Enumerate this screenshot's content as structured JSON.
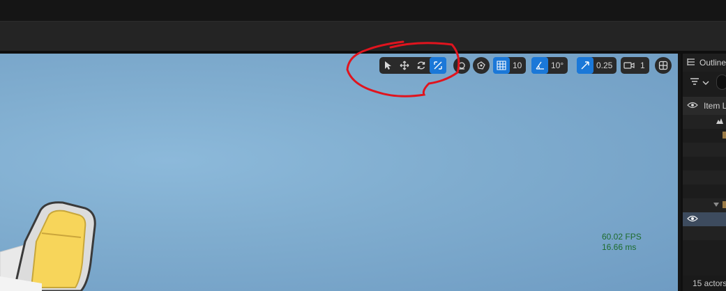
{
  "viewport": {
    "transform_tools": [
      "select",
      "translate",
      "rotate",
      "scale"
    ],
    "grid_snap_value": "10",
    "rotation_snap_value": "10°",
    "scale_snap_value": "0.25",
    "camera_speed_value": "1",
    "stats": {
      "fps": "60.02 FPS",
      "frame_time": "16.66 ms"
    },
    "annotation_color": "#e0141e"
  },
  "outliner": {
    "title": "Outline",
    "column_label": "Item L",
    "footer": "15 actors"
  },
  "colors": {
    "accent": "#1b78d8",
    "selection": "#3d4b5e"
  }
}
